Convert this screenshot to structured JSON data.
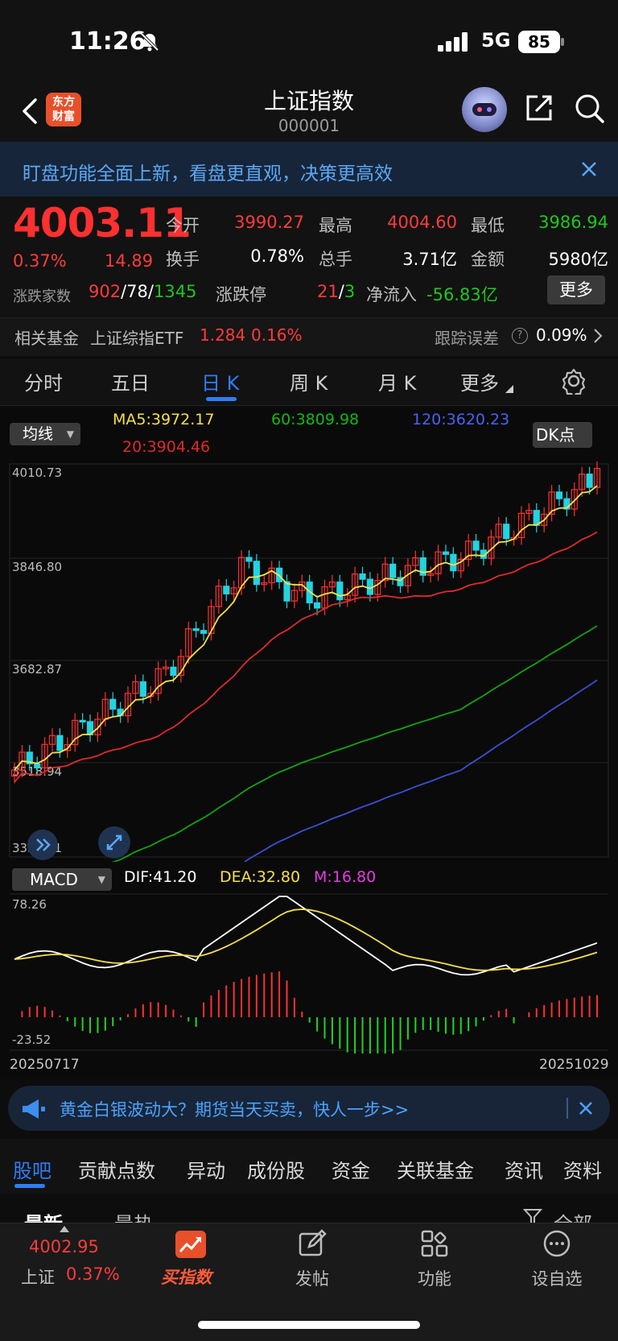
{
  "status": {
    "time": "11:26",
    "network": "5G",
    "battery": "85"
  },
  "header": {
    "logo": "东方\n财富",
    "title": "上证指数",
    "code": "000001"
  },
  "banner": {
    "text": "盯盘功能全面上新，看盘更直观，决策更高效"
  },
  "quote": {
    "price": "4003.11",
    "pct": "0.37%",
    "change": "14.89",
    "open_label": "今开",
    "open": "3990.27",
    "high_label": "最高",
    "high": "4004.60",
    "low_label": "最低",
    "low": "3986.94",
    "turnover_label": "换手",
    "turnover": "0.78%",
    "volume_label": "总手",
    "volume": "3.71亿",
    "amount_label": "金额",
    "amount": "5980亿",
    "breadth_label": "涨跌家数",
    "up": "902",
    "flat": "78",
    "down": "1345",
    "limit_label": "涨跌停",
    "limit_up": "21",
    "limit_down": "3",
    "inflow_label": "净流入",
    "inflow": "-56.83亿",
    "more": "更多"
  },
  "related_fund": {
    "label": "相关基金",
    "name": "上证综指ETF",
    "price": "1.284",
    "pct": "0.16%",
    "tracking_label": "跟踪误差",
    "tracking": "0.09%"
  },
  "tabs": [
    "分时",
    "五日",
    "日 K",
    "周 K",
    "月 K",
    "更多"
  ],
  "chart": {
    "ma_select": "均线",
    "ma5": "MA5:3972.17",
    "ma20": "20:3904.46",
    "ma60": "60:3809.98",
    "ma120": "120:3620.23",
    "dk": "DK点",
    "price_ticks": [
      "4010.73",
      "3846.80",
      "3682.87",
      "3518.94",
      "3355.01"
    ],
    "macd_select": "MACD",
    "dif": "DIF:41.20",
    "dea": "DEA:32.80",
    "m": "M:16.80",
    "macd_ticks": [
      "78.26",
      "-23.52"
    ],
    "date_start": "20250717",
    "date_end": "20251029",
    "colors": {
      "ma5": "#f5e04a",
      "ma20": "#e02a2a",
      "ma60": "#12a312",
      "ma120": "#3a4fd8",
      "up": "#ff3030",
      "down": "#22d3e0"
    }
  },
  "ad": {
    "text": "黄金白银波动大？期货当天买卖，快人一步>>"
  },
  "sub_tabs": [
    "股吧",
    "贡献点数",
    "异动",
    "成份股",
    "资金",
    "关联基金",
    "资讯",
    "资料"
  ],
  "feed_tabs": {
    "latest": "最新",
    "hot": "最热",
    "filter": "全部"
  },
  "bottom_nav": {
    "index_value": "4002.95",
    "index_name": "上证",
    "index_pct": "0.37%",
    "buy_label": "买指数",
    "post_label": "发帖",
    "func_label": "功能",
    "watch_label": "设自选"
  }
}
